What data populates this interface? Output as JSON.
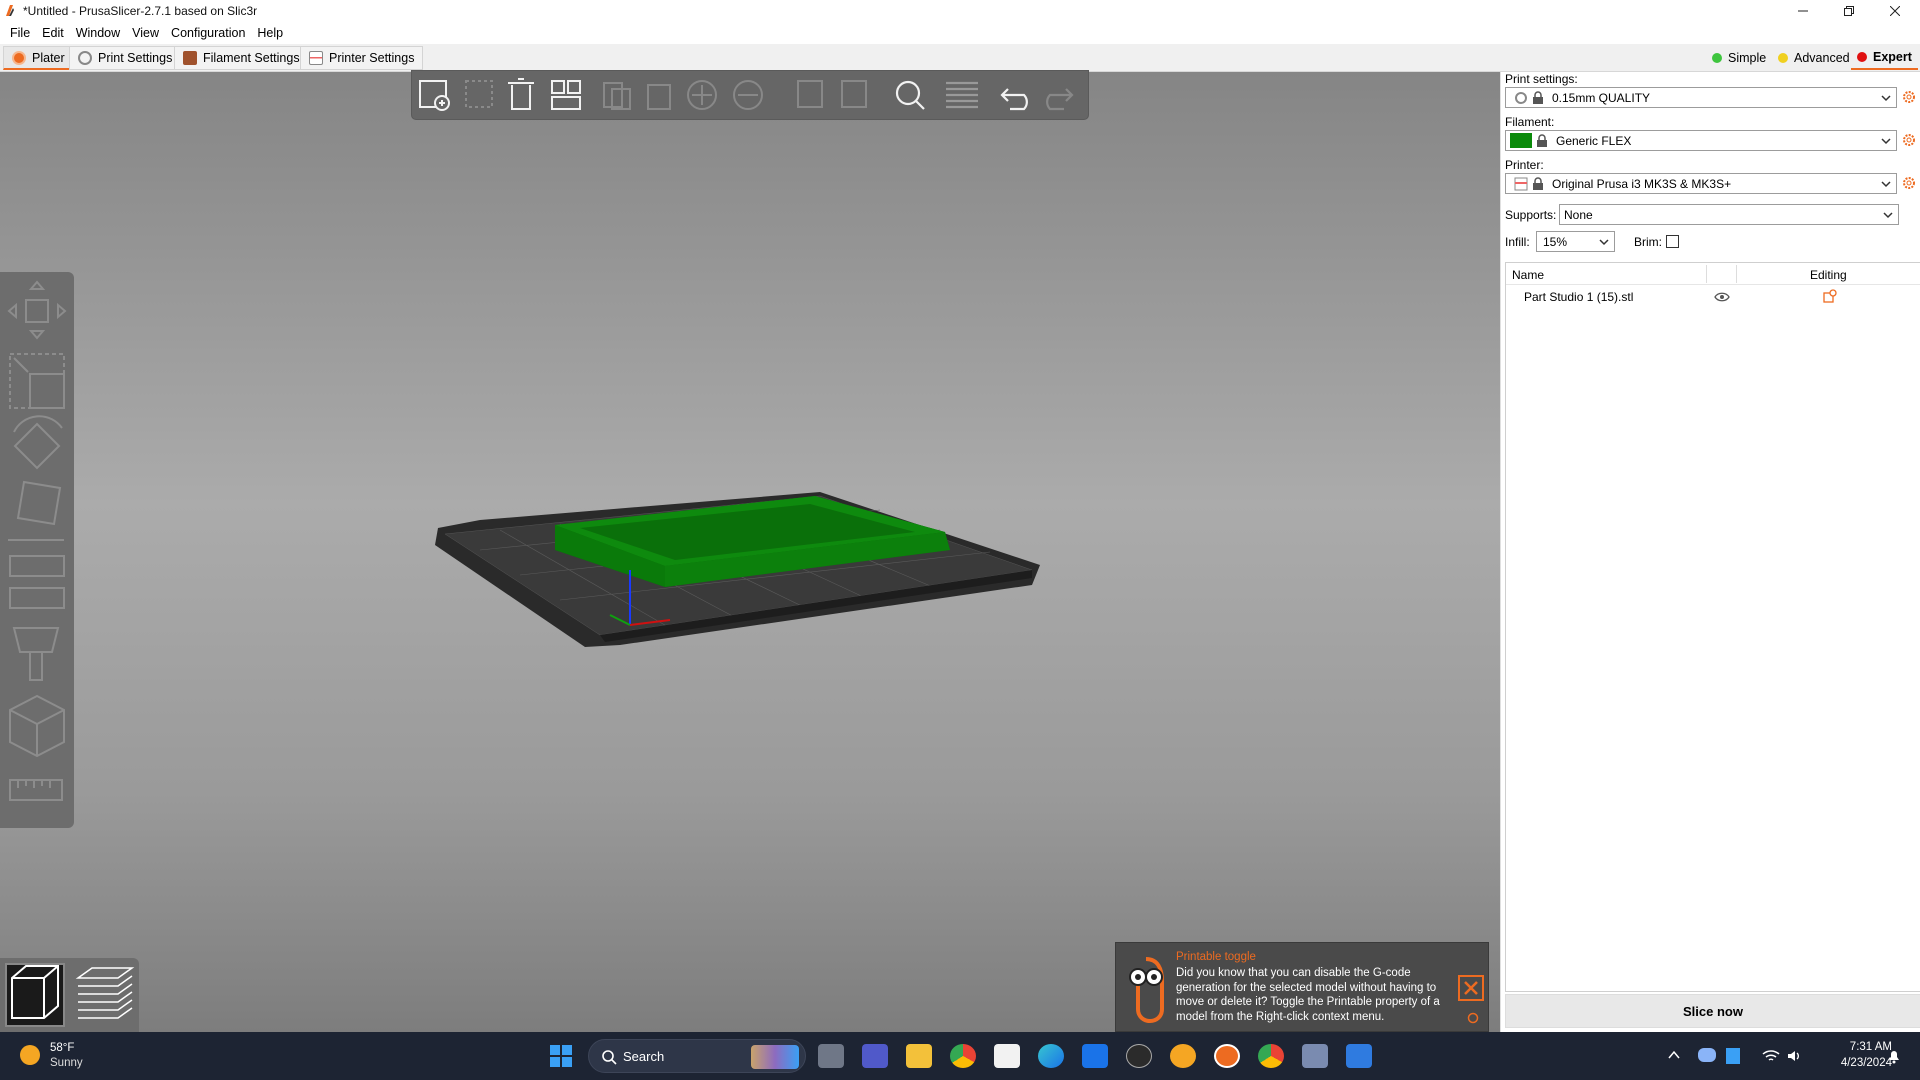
{
  "window": {
    "title": "*Untitled - PrusaSlicer-2.7.1 based on Slic3r"
  },
  "menu": [
    "File",
    "Edit",
    "Window",
    "View",
    "Configuration",
    "Help"
  ],
  "tabs": [
    {
      "label": "Plater",
      "icon": "plater-icon"
    },
    {
      "label": "Print Settings",
      "icon": "print-settings-icon"
    },
    {
      "label": "Filament Settings",
      "icon": "filament-settings-icon"
    },
    {
      "label": "Printer Settings",
      "icon": "printer-settings-icon"
    }
  ],
  "modes": [
    {
      "label": "Simple",
      "color": "#3ec53e"
    },
    {
      "label": "Advanced",
      "color": "#f0d020"
    },
    {
      "label": "Expert",
      "color": "#e01010"
    }
  ],
  "toolbar_icons": [
    "add-icon",
    "delete-icon",
    "delete-all-icon",
    "arrange-icon",
    "copy-icon",
    "paste-icon",
    "add-instance-icon",
    "remove-instance-icon",
    "split-objects-icon",
    "split-parts-icon",
    "search-icon",
    "layers-editing-icon",
    "undo-icon",
    "redo-icon"
  ],
  "gizmo_icons": [
    "move-icon",
    "scale-icon",
    "rotate-icon",
    "place-on-face-icon",
    "cut-icon",
    "supports-paint-icon",
    "seam-paint-icon",
    "measure-icon"
  ],
  "view_toggle": [
    "3d-view-icon",
    "preview-icon"
  ],
  "sidebar": {
    "print_settings_label": "Print settings:",
    "print_settings_value": "0.15mm QUALITY",
    "filament_label": "Filament:",
    "filament_value": "Generic FLEX",
    "filament_color": "#0a8a0a",
    "printer_label": "Printer:",
    "printer_value": "Original Prusa i3 MK3S & MK3S+",
    "supports_label": "Supports:",
    "supports_value": "None",
    "infill_label": "Infill:",
    "infill_value": "15%",
    "brim_label": "Brim:",
    "brim_checked": false,
    "list_headers": {
      "name": "Name",
      "editing": "Editing"
    },
    "objects": [
      {
        "name": "Part Studio 1 (15).stl"
      }
    ],
    "slice_button": "Slice now"
  },
  "notification": {
    "title": "Printable toggle",
    "body": "Did you know that you can disable the G-code generation for the selected model without having to move or delete it? Toggle the Printable property of a model from the Right-click context menu."
  },
  "taskbar": {
    "weather_temp": "58°F",
    "weather_desc": "Sunny",
    "search_label": "Search",
    "time": "7:31 AM",
    "date": "4/23/2024"
  },
  "accent_color": "#ed6b21"
}
